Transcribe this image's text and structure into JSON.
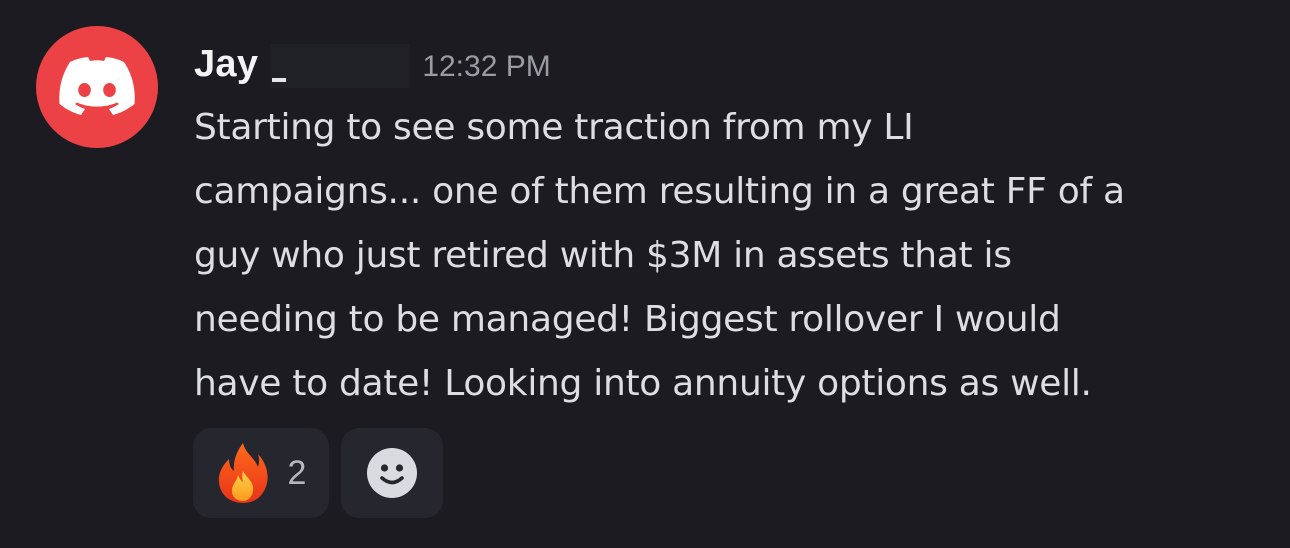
{
  "message": {
    "author": "Jay",
    "timestamp": "12:32 PM",
    "avatar_icon": "discord-logo-icon",
    "avatar_color": "#ed4245",
    "lines": [
      "Starting to see some traction from my LI",
      "campaigns... one of them resulting in a great FF of a",
      "guy who just retired with $3M in assets that is",
      "needing to be managed! Biggest rollover I would",
      "have to date! Looking into annuity options as well."
    ]
  },
  "reactions": [
    {
      "icon": "fire-emoji-icon",
      "count": "2"
    },
    {
      "icon": "add-reaction-smile-icon"
    }
  ],
  "colors": {
    "background": "#1b1b21",
    "reaction_bg": "#26272e"
  }
}
